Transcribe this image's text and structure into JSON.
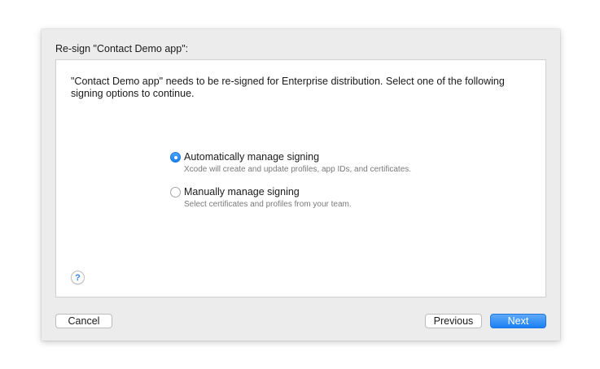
{
  "dialog": {
    "title": "Re-sign \"Contact Demo app\":"
  },
  "panel": {
    "description": "\"Contact Demo app\" needs to be re-signed for Enterprise distribution. Select one of the following signing options to continue."
  },
  "options": [
    {
      "label": "Automatically manage signing",
      "description": "Xcode will create and update profiles, app IDs, and certificates.",
      "selected": true
    },
    {
      "label": "Manually manage signing",
      "description": "Select certificates and profiles from your team.",
      "selected": false
    }
  ],
  "help": {
    "symbol": "?"
  },
  "buttons": {
    "cancel": "Cancel",
    "previous": "Previous",
    "next": "Next"
  },
  "colors": {
    "accent": "#1a7ff3",
    "dialog_background": "#ececec",
    "panel_background": "#ffffff"
  }
}
